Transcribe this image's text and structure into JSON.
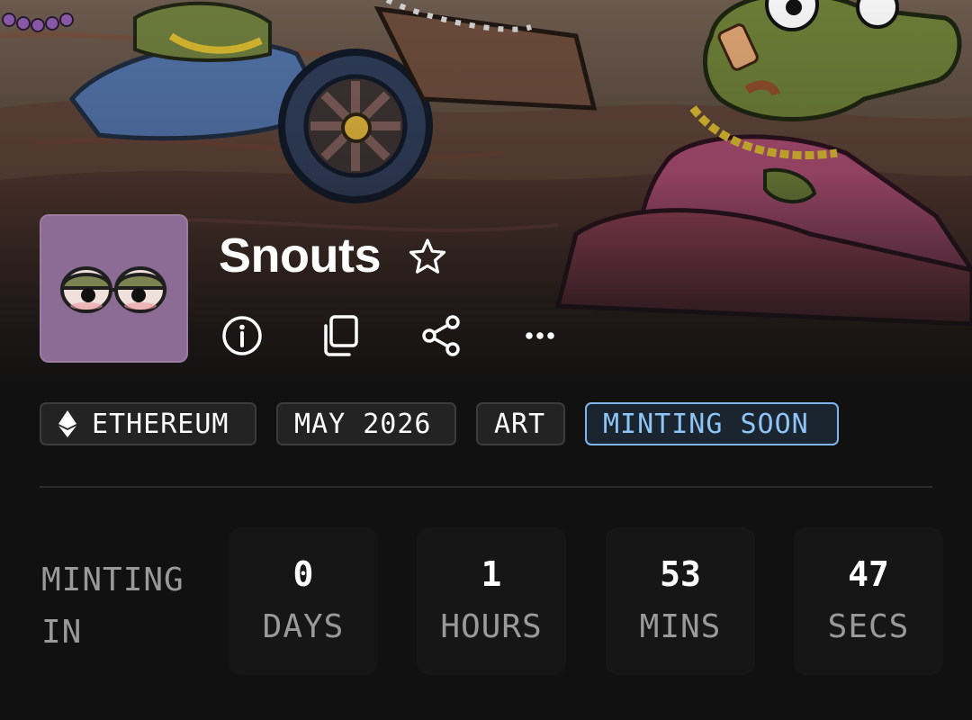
{
  "collection": {
    "name": "Snouts"
  },
  "actions": [
    {
      "name": "info-icon"
    },
    {
      "name": "copy-icon"
    },
    {
      "name": "share-icon"
    },
    {
      "name": "more-icon"
    }
  ],
  "tags": [
    {
      "label": "ETHEREUM",
      "icon": "ethereum-icon"
    },
    {
      "label": "MAY 2026"
    },
    {
      "label": "ART"
    },
    {
      "label": "MINTING SOON",
      "accent": "#8ec4f6"
    }
  ],
  "countdown": {
    "label_line1": "MINTING",
    "label_line2": "IN",
    "units": [
      {
        "value": "0",
        "unit": "DAYS"
      },
      {
        "value": "1",
        "unit": "HOURS"
      },
      {
        "value": "53",
        "unit": "MINS"
      },
      {
        "value": "47",
        "unit": "SECS"
      }
    ]
  },
  "colors": {
    "background": "#111111",
    "avatar_bg": "#8c6b94",
    "accent": "#8ec4f6",
    "muted_text": "#9a9a9a"
  }
}
